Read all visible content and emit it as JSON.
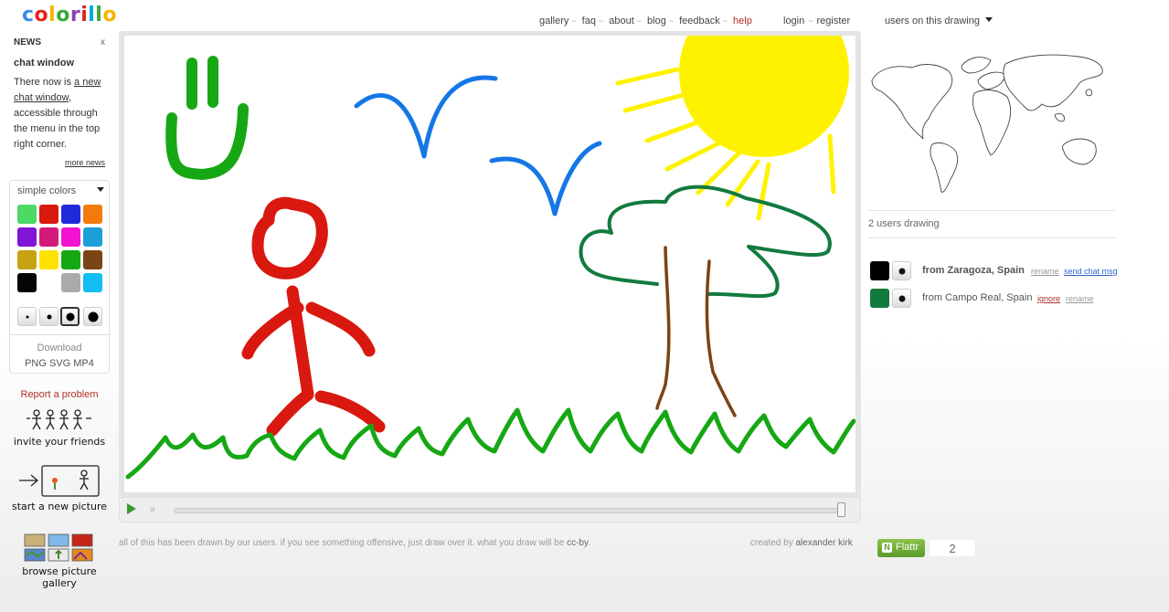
{
  "app": {
    "logo": [
      "c",
      "o",
      "l",
      "o",
      "r",
      "i",
      "l",
      "l",
      "o"
    ],
    "logo_colors": [
      "#3a8ee6",
      "#e2231a",
      "#f7b500",
      "#3aa935",
      "#8e44ad",
      "#e2231a",
      "#00a9e0",
      "#3aa935",
      "#f7b500"
    ]
  },
  "news": {
    "header": "NEWS",
    "close": "x",
    "title": "chat window",
    "body_pre": "There now is ",
    "body_link": "a new chat window",
    "body_post": ", accessible through the menu in the top right corner.",
    "more": "more news"
  },
  "palette": {
    "selected": "simple colors",
    "colors": [
      "#4cd964",
      "#d9180f",
      "#1f2bdb",
      "#f57a0d",
      "#7f15d6",
      "#d4197c",
      "#f212d2",
      "#1a9fd6",
      "#c6a212",
      "#ffe100",
      "#16a814",
      "#7a4414",
      "#050505",
      "#ffffff",
      "#aaaaaa",
      "#12bdf4"
    ],
    "download_label": "Download",
    "formats": "PNG SVG MP4"
  },
  "sidebar": {
    "report": "Report a problem",
    "invite": "invite your friends",
    "new_picture": "start a new picture",
    "gallery": "browse picture gallery"
  },
  "nav": {
    "items": [
      "gallery",
      "faq",
      "about",
      "blog",
      "feedback"
    ],
    "help": "help",
    "login": "login",
    "register": "register",
    "users_dropdown": "users on this drawing"
  },
  "users": {
    "count_text": "2 users drawing",
    "list": [
      {
        "color": "#000000",
        "location": "from Zaragoza, Spain",
        "bold": true,
        "actions": [
          {
            "label": "rename",
            "color": "#999999"
          },
          {
            "label": "send chat msg",
            "color": "#3366cc"
          }
        ]
      },
      {
        "color": "#137a3e",
        "location": "from Campo Real, Spain",
        "bold": false,
        "actions": [
          {
            "label": "ignore",
            "color": "#b0322a"
          },
          {
            "label": "rename",
            "color": "#999999"
          }
        ]
      }
    ]
  },
  "footer": {
    "text": "all of this has been drawn by our users. if you see something offensive, just draw over it. what you draw will be ",
    "cc": "cc-by",
    "dot": ".",
    "created_by": "created by ",
    "author": "alexander kirk"
  },
  "flattr": {
    "label": "Flattr",
    "count": "2"
  }
}
